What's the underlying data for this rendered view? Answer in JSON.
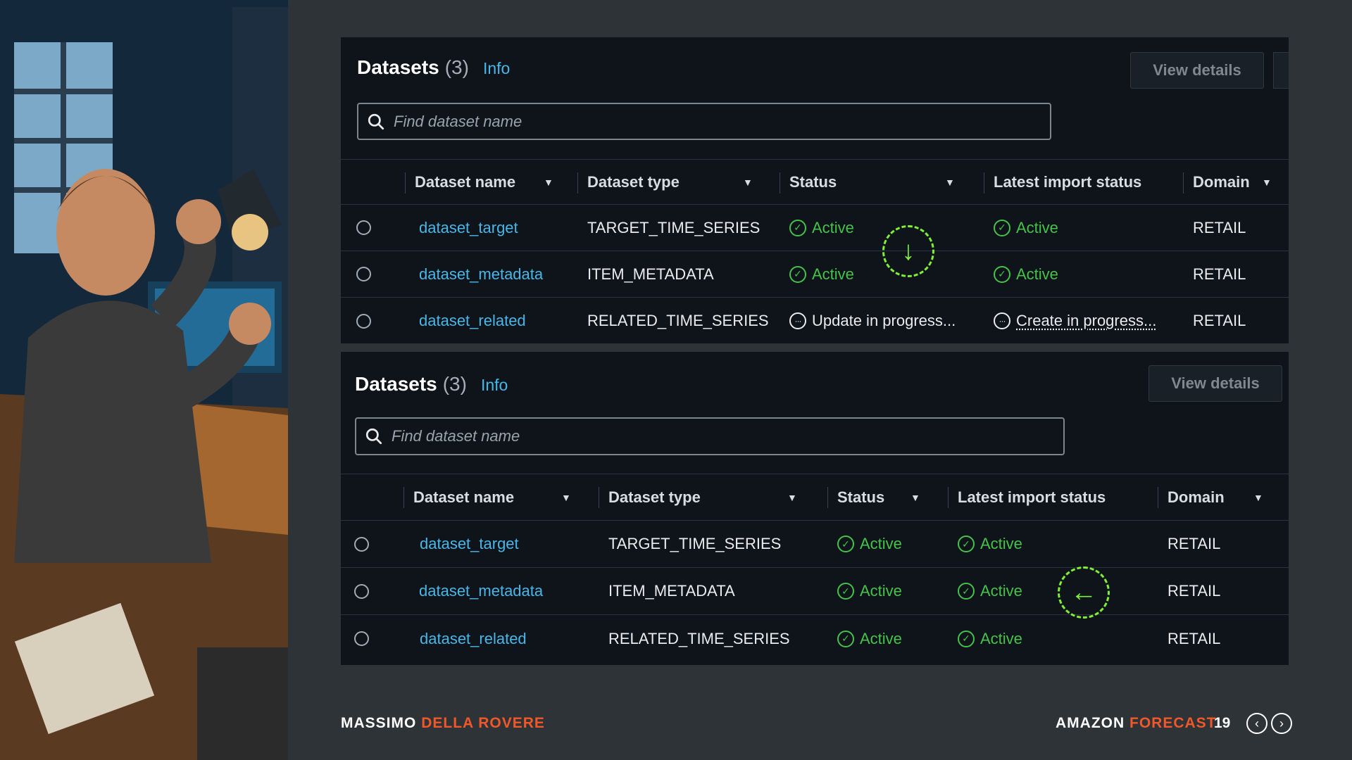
{
  "panels": [
    {
      "title": "Datasets",
      "count": "(3)",
      "info": "Info",
      "view_details": "View details",
      "search_placeholder": "Find dataset name",
      "columns": [
        "Dataset name",
        "Dataset type",
        "Status",
        "Latest import status",
        "Domain"
      ],
      "rows": [
        {
          "name": "dataset_target",
          "type": "TARGET_TIME_SERIES",
          "status": "Active",
          "status_kind": "ok",
          "import": "Active",
          "import_kind": "ok",
          "domain": "RETAIL"
        },
        {
          "name": "dataset_metadata",
          "type": "ITEM_METADATA",
          "status": "Active",
          "status_kind": "ok",
          "import": "Active",
          "import_kind": "ok",
          "domain": "RETAIL"
        },
        {
          "name": "dataset_related",
          "type": "RELATED_TIME_SERIES",
          "status": "Update in progress...",
          "status_kind": "progress",
          "import": "Create in progress...",
          "import_kind": "progress",
          "domain": "RETAIL"
        }
      ]
    },
    {
      "title": "Datasets",
      "count": "(3)",
      "info": "Info",
      "view_details": "View details",
      "search_placeholder": "Find dataset name",
      "columns": [
        "Dataset name",
        "Dataset type",
        "Status",
        "Latest import status",
        "Domain"
      ],
      "rows": [
        {
          "name": "dataset_target",
          "type": "TARGET_TIME_SERIES",
          "status": "Active",
          "status_kind": "ok",
          "import": "Active",
          "import_kind": "ok",
          "domain": "RETAIL"
        },
        {
          "name": "dataset_metadata",
          "type": "ITEM_METADATA",
          "status": "Active",
          "status_kind": "ok",
          "import": "Active",
          "import_kind": "ok",
          "domain": "RETAIL"
        },
        {
          "name": "dataset_related",
          "type": "RELATED_TIME_SERIES",
          "status": "Active",
          "status_kind": "ok",
          "import": "Active",
          "import_kind": "ok",
          "domain": "RETAIL"
        }
      ]
    }
  ],
  "markers": {
    "down": "↓",
    "left": "←"
  },
  "footer": {
    "author_first": "MASSIMO",
    "author_last": "DELLA ROVERE",
    "product_first": "AMAZON",
    "product_last": "FORECAST",
    "page": "19",
    "prev": "‹",
    "next": "›"
  },
  "colors": {
    "accent": "#f0582a",
    "link": "#46b7e8",
    "success": "#44c24a",
    "marker": "#7ef036"
  },
  "icons": [
    "search-icon",
    "check-circle-icon",
    "in-progress-icon",
    "sort-caret-icon",
    "arrow-down-icon",
    "arrow-left-icon",
    "chevron-left-icon",
    "chevron-right-icon"
  ]
}
